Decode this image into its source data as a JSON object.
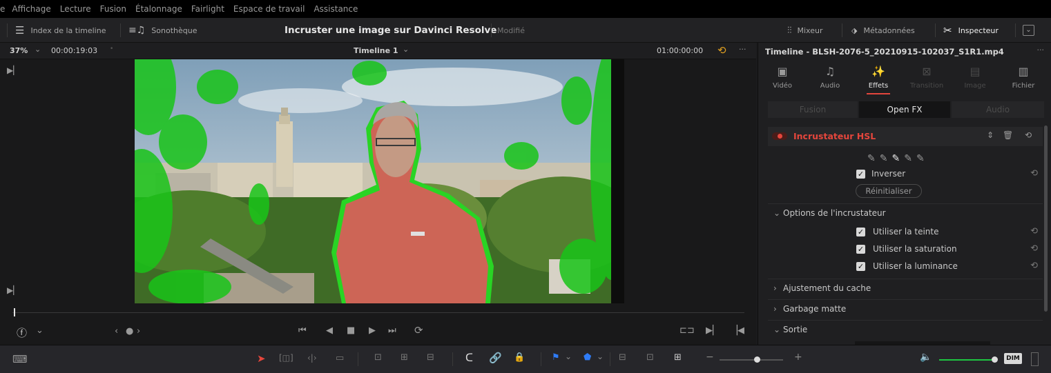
{
  "menubar": {
    "items": [
      "e",
      "Affichage",
      "Lecture",
      "Fusion",
      "Étalonnage",
      "Fairlight",
      "Espace de travail",
      "Assistance"
    ]
  },
  "toolbar": {
    "index_label": "Index de la timeline",
    "library_label": "Sonothèque",
    "project_title": "Incruster une image sur Davinci Resolve",
    "project_status": "Modifié",
    "mixer_label": "Mixeur",
    "metadata_label": "Métadonnées",
    "inspector_label": "Inspecteur"
  },
  "viewer": {
    "zoom": "37%",
    "timecode": "00:00:19:03",
    "timeline_name": "Timeline 1",
    "timecode_right": "01:00:00:00",
    "more": "···"
  },
  "inspector": {
    "clip_title": "Timeline - BLSH-2076-5_20210915-102037_S1R1.mp4",
    "more": "···",
    "tabs": [
      {
        "label": "Vidéo",
        "icon": "video-icon",
        "state": "normal"
      },
      {
        "label": "Audio",
        "icon": "audio-icon",
        "state": "normal"
      },
      {
        "label": "Effets",
        "icon": "effects-wand-icon",
        "state": "active"
      },
      {
        "label": "Transition",
        "icon": "transition-icon",
        "state": "disabled"
      },
      {
        "label": "Image",
        "icon": "image-icon",
        "state": "disabled"
      },
      {
        "label": "Fichier",
        "icon": "file-icon",
        "state": "normal"
      }
    ],
    "segments": [
      "Fusion",
      "Open FX",
      "Audio"
    ],
    "segment_active": "Open FX",
    "effect_name": "Incrustateur HSL",
    "invert_label": "Inverser",
    "reset_button": "Réinitialiser",
    "keyer_options_title": "Options de l'incrustateur",
    "keyer_options": [
      {
        "label": "Utiliser la teinte",
        "checked": true
      },
      {
        "label": "Utiliser la saturation",
        "checked": true
      },
      {
        "label": "Utiliser la luminance",
        "checked": true
      }
    ],
    "matte_finesse_title": "Ajustement du cache",
    "garbage_matte_title": "Garbage matte",
    "output_title": "Sortie"
  },
  "bottombar": {
    "dim_label": "DIM"
  },
  "colors": {
    "accent_red": "#e5463c",
    "blue_flag": "#2f7cf6",
    "green_key": "#22d11e",
    "text": "#c9c9c9"
  }
}
